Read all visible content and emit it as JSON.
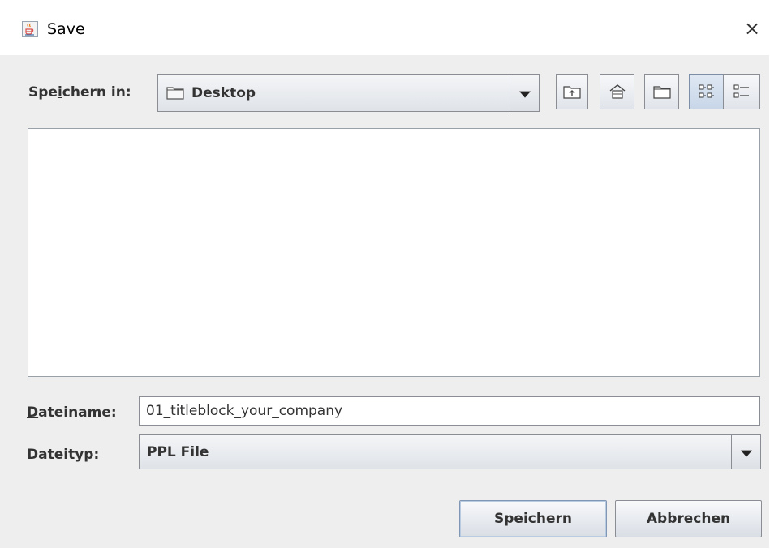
{
  "window": {
    "title": "Save",
    "close_glyph": "×",
    "icon": "java-cup-icon"
  },
  "lookin": {
    "label_before": "Spe",
    "label_mnemonic": "i",
    "label_after": "chern in:",
    "value": "Desktop",
    "icon": "folder-icon"
  },
  "toolbar": {
    "buttons": [
      {
        "name": "up-one-level",
        "icon": "folder-up-icon"
      },
      {
        "name": "home",
        "icon": "home-icon"
      },
      {
        "name": "new-folder",
        "icon": "new-folder-icon"
      },
      {
        "name": "list-view",
        "icon": "list-view-icon",
        "active": true
      },
      {
        "name": "details-view",
        "icon": "details-view-icon",
        "active": false
      }
    ]
  },
  "filename": {
    "label_mnemonic": "D",
    "label_after": "ateiname:",
    "value": "01_titleblock_your_company"
  },
  "filetype": {
    "label_before": "Da",
    "label_mnemonic": "t",
    "label_after": "eityp:",
    "value": "PPL File"
  },
  "buttons": {
    "save": "Speichern",
    "cancel": "Abbrechen"
  }
}
